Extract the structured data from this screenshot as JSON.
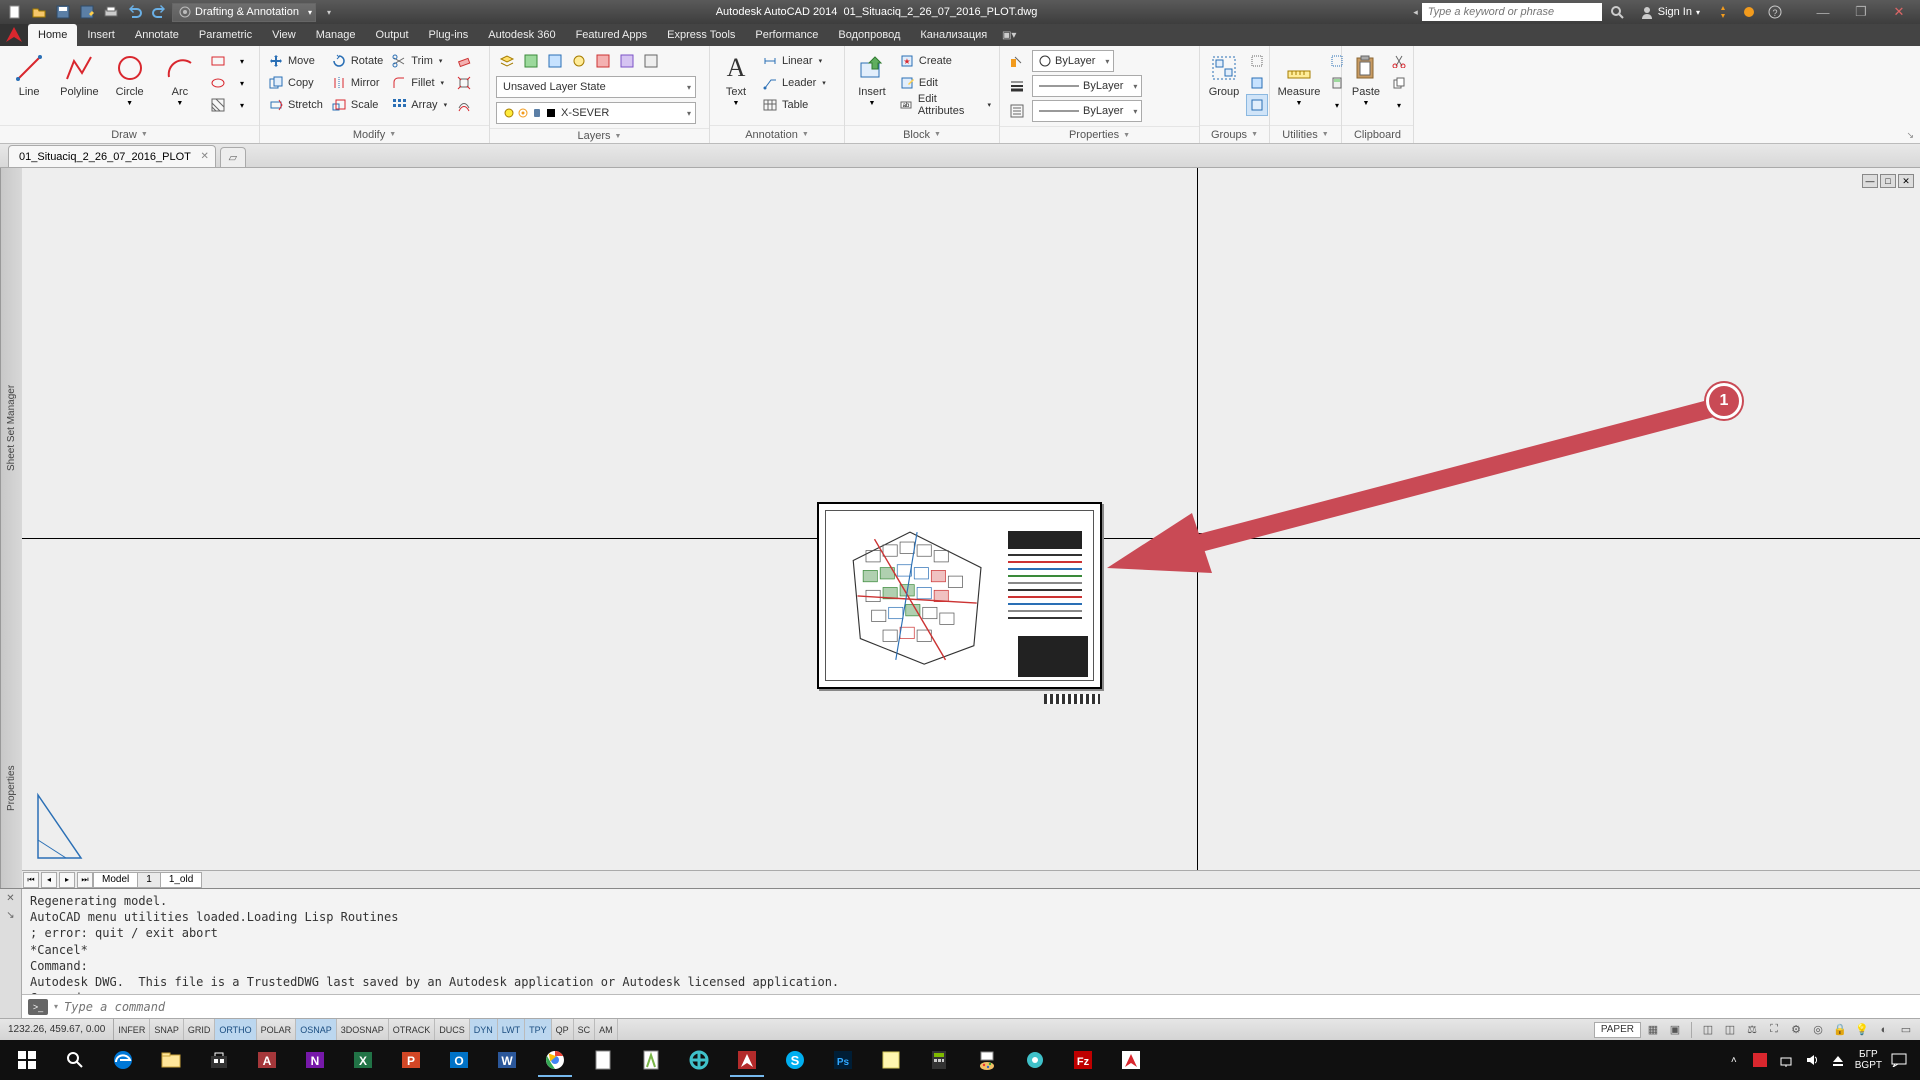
{
  "app": {
    "name": "Autodesk AutoCAD 2014",
    "filename": "01_Situaciq_2_26_07_2016_PLOT.dwg",
    "workspace": "Drafting & Annotation",
    "search_placeholder": "Type a keyword or phrase",
    "signin": "Sign In"
  },
  "menus": [
    "Home",
    "Insert",
    "Annotate",
    "Parametric",
    "View",
    "Manage",
    "Output",
    "Plug-ins",
    "Autodesk 360",
    "Featured Apps",
    "Express Tools",
    "Performance",
    "Водопровод",
    "Канализация"
  ],
  "ribbon": {
    "draw": {
      "title": "Draw",
      "line": "Line",
      "polyline": "Polyline",
      "circle": "Circle",
      "arc": "Arc"
    },
    "modify": {
      "title": "Modify",
      "move": "Move",
      "rotate": "Rotate",
      "trim": "Trim",
      "copy": "Copy",
      "mirror": "Mirror",
      "fillet": "Fillet",
      "stretch": "Stretch",
      "scale": "Scale",
      "array": "Array"
    },
    "layers": {
      "title": "Layers",
      "state": "Unsaved Layer State",
      "current": "X-SEVER"
    },
    "annotation": {
      "title": "Annotation",
      "text": "Text",
      "linear": "Linear",
      "leader": "Leader",
      "table": "Table"
    },
    "block": {
      "title": "Block",
      "insert": "Insert",
      "create": "Create",
      "edit": "Edit",
      "edit_attr": "Edit Attributes"
    },
    "properties": {
      "title": "Properties",
      "layer": "ByLayer"
    },
    "groups": {
      "title": "Groups",
      "group": "Group"
    },
    "utilities": {
      "title": "Utilities",
      "measure": "Measure"
    },
    "clipboard": {
      "title": "Clipboard",
      "paste": "Paste"
    }
  },
  "doc_tab": "01_Situaciq_2_26_07_2016_PLOT",
  "side_tabs": {
    "sheet": "Sheet Set Manager",
    "props": "Properties"
  },
  "layout_tabs": [
    "Model",
    "1",
    "1_old"
  ],
  "command_log": "Regenerating model.\nAutoCAD menu utilities loaded.Loading Lisp Routines\n; error: quit / exit abort\n*Cancel*\nCommand:\nAutodesk DWG.  This file is a TrustedDWG last saved by an Autodesk application or Autodesk licensed application.\nCommand:",
  "command_placeholder": "Type a command",
  "status": {
    "coords": "1232.26, 459.67, 0.00",
    "toggles": [
      {
        "l": "INFER",
        "on": false
      },
      {
        "l": "SNAP",
        "on": false
      },
      {
        "l": "GRID",
        "on": false
      },
      {
        "l": "ORTHO",
        "on": true
      },
      {
        "l": "POLAR",
        "on": false
      },
      {
        "l": "OSNAP",
        "on": true
      },
      {
        "l": "3DOSNAP",
        "on": false
      },
      {
        "l": "OTRACK",
        "on": false
      },
      {
        "l": "DUCS",
        "on": false
      },
      {
        "l": "DYN",
        "on": true
      },
      {
        "l": "LWT",
        "on": true
      },
      {
        "l": "TPY",
        "on": true
      },
      {
        "l": "QP",
        "on": false
      },
      {
        "l": "SC",
        "on": false
      },
      {
        "l": "AM",
        "on": false
      }
    ],
    "space": "PAPER"
  },
  "annotation_badge": "1",
  "tray": {
    "lang1": "БГР",
    "lang2": "BGPT",
    "time": ""
  }
}
